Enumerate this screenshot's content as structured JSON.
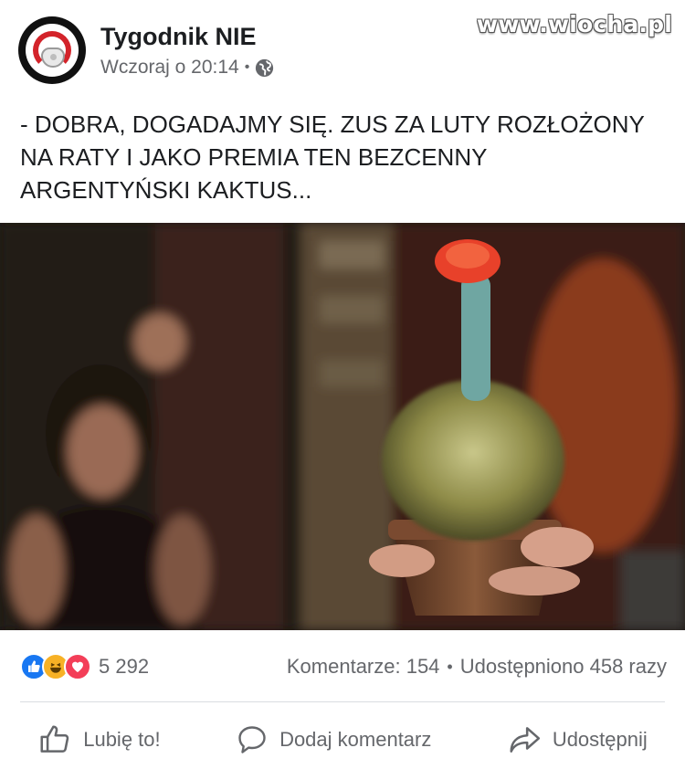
{
  "watermark": "www.wiocha.pl",
  "post": {
    "page_name": "Tygodnik NIE",
    "timestamp": "Wczoraj o 20:14",
    "meta_separator": "•",
    "audience_icon": "globe-icon",
    "text": "- DOBRA, DOGADAJMY SIĘ. ZUS ZA LUTY ROZŁOŻONY NA RATY I JAKO PREMIA TEN BEZCENNY ARGENTYŃSKI KAKTUS..."
  },
  "reactions": {
    "icons": [
      "like-icon",
      "haha-icon",
      "love-icon"
    ],
    "count": "5 292",
    "comments": "Komentarze: 154",
    "separator": "•",
    "shares": "Udostępniono 458 razy"
  },
  "actions": {
    "like_label": "Lubię to!",
    "comment_label": "Dodaj komentarz",
    "share_label": "Udostępnij"
  },
  "colors": {
    "like_blue": "#1877f2",
    "haha_yellow": "#f7b125",
    "love_red": "#f33e58",
    "secondary_text": "#65676b",
    "avatar_red": "#d3232a"
  }
}
